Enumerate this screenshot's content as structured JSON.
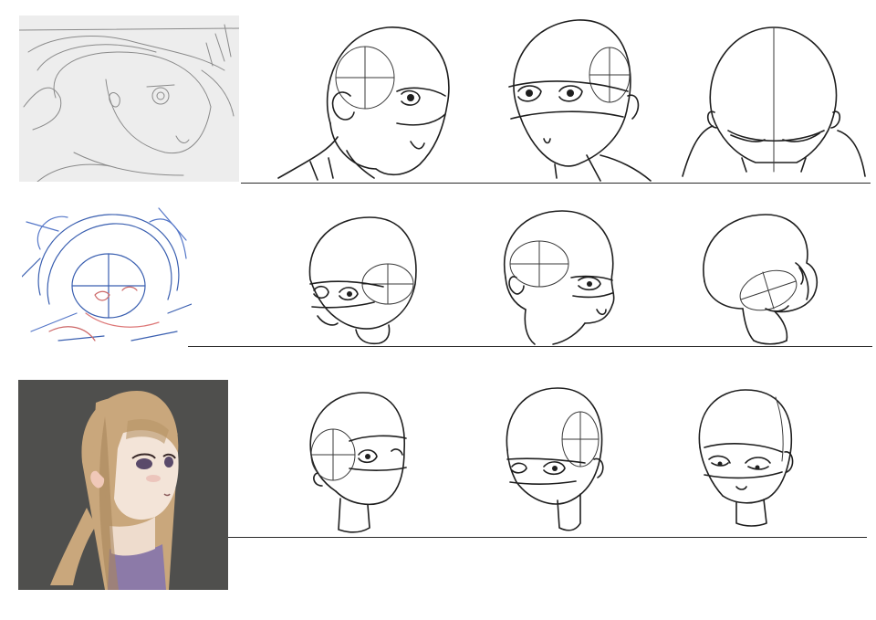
{
  "sheet": {
    "background_color": "#ffffff",
    "line_color": "#1e1e1e",
    "rows": [
      {
        "reference_type": "pencil-sketch",
        "reference_bg": "#ededed",
        "views": [
          "three-quarter-left",
          "three-quarter-right",
          "top-down"
        ]
      },
      {
        "reference_type": "color-pencil-rough",
        "reference_bg": "#ffffff",
        "views": [
          "low-angle-left",
          "profile-right",
          "tilted-back"
        ]
      },
      {
        "reference_type": "color-illustration",
        "reference_bg": "#4f4f4d",
        "views": [
          "three-quarter-right",
          "three-quarter-left",
          "front-tilted"
        ]
      }
    ],
    "palette": {
      "hair": "#c9a77c",
      "hair_shadow": "#a8865c",
      "skin": "#f3e4d8",
      "shirt": "#8c7aa8"
    }
  }
}
